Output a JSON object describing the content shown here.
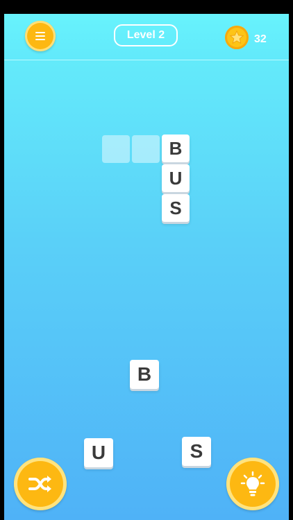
{
  "header": {
    "menu_icon": "menu-icon",
    "level_label": "Level 2",
    "coin_icon": "star-coin-icon",
    "coin_count": "32"
  },
  "board": {
    "placed_letters": [
      "B",
      "U",
      "S"
    ],
    "empty_slots": 2
  },
  "tray": {
    "letters": [
      "B",
      "U",
      "S"
    ]
  },
  "controls": {
    "shuffle_icon": "shuffle-icon",
    "hint_icon": "lightbulb-icon"
  },
  "colors": {
    "accent": "#fdb812",
    "background_top": "#66f1fb",
    "background_bottom": "#4fb2f7"
  }
}
